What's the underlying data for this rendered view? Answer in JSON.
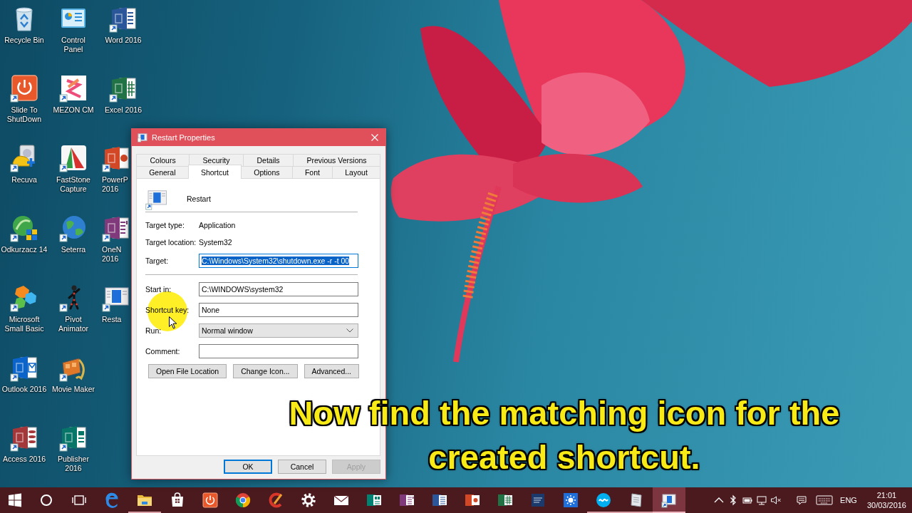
{
  "desktop_icons": [
    {
      "label": "Recycle Bin",
      "partly_covered": false
    },
    {
      "label": "Slide To ShutDown",
      "partly_covered": false
    },
    {
      "label": "Recuva",
      "partly_covered": false
    },
    {
      "label": "Odkurzacz 14",
      "partly_covered": false
    },
    {
      "label": "Microsoft Small Basic",
      "partly_covered": false
    },
    {
      "label": "Outlook 2016",
      "partly_covered": false
    },
    {
      "label": "Access 2016",
      "partly_covered": false
    },
    {
      "label": "Control Panel",
      "partly_covered": false
    },
    {
      "label": "MEZON CM",
      "partly_covered": false
    },
    {
      "label": "FastStone Capture",
      "partly_covered": false
    },
    {
      "label": "Seterra",
      "partly_covered": false
    },
    {
      "label": "Pivot Animator",
      "partly_covered": false
    },
    {
      "label": "Movie Maker",
      "partly_covered": false
    },
    {
      "label": "Publisher 2016",
      "partly_covered": false
    },
    {
      "label": "Word 2016",
      "partly_covered": false
    },
    {
      "label": "Excel 2016",
      "partly_covered": false
    },
    {
      "label": "PowerP 2016",
      "partly_covered": true
    },
    {
      "label": "OneN 2016",
      "partly_covered": true
    },
    {
      "label": "Resta",
      "partly_covered": true
    }
  ],
  "window": {
    "title": "Restart Properties",
    "tab_rows": [
      [
        {
          "label": "Colours",
          "selected": false
        },
        {
          "label": "Security",
          "selected": false
        },
        {
          "label": "Details",
          "selected": false
        },
        {
          "label": "Previous Versions",
          "selected": false
        }
      ],
      [
        {
          "label": "General",
          "selected": false
        },
        {
          "label": "Shortcut",
          "selected": true
        },
        {
          "label": "Options",
          "selected": false
        },
        {
          "label": "Font",
          "selected": false
        },
        {
          "label": "Layout",
          "selected": false
        }
      ]
    ],
    "shortcut_name": "Restart",
    "info_rows": [
      {
        "label": "Target type:",
        "value": "Application"
      },
      {
        "label": "Target location:",
        "value": "System32"
      }
    ],
    "target": {
      "label": "Target:",
      "value": "C:\\Windows\\System32\\shutdown.exe -r -t 00",
      "text_selected": true
    },
    "fields": [
      {
        "kind": "input",
        "label": "Start in:",
        "value": "C:\\WINDOWS\\system32"
      },
      {
        "kind": "input",
        "label": "Shortcut key:",
        "value": "None"
      },
      {
        "kind": "dropdown",
        "label": "Run:",
        "value": "Normal window"
      },
      {
        "kind": "input",
        "label": "Comment:"
      }
    ],
    "actions": [
      "Open File Location",
      "Change Icon...",
      "Advanced..."
    ],
    "footer_buttons": [
      {
        "label": "OK",
        "focused": true,
        "disabled": false
      },
      {
        "label": "Cancel",
        "focused": false,
        "disabled": false
      },
      {
        "label": "Apply",
        "focused": false,
        "disabled": true
      }
    ]
  },
  "caption_lines": [
    "Now find the matching icon for the",
    "created shortcut."
  ],
  "taskbar": {
    "apps": [
      {
        "running": false,
        "selected": false
      },
      {
        "running": true,
        "selected": false
      },
      {
        "running": false,
        "selected": false
      },
      {
        "running": false,
        "selected": false
      },
      {
        "running": false,
        "selected": false
      },
      {
        "running": false,
        "selected": false
      },
      {
        "running": false,
        "selected": false
      },
      {
        "running": false,
        "selected": false
      },
      {
        "running": false,
        "selected": false
      },
      {
        "running": false,
        "selected": false
      },
      {
        "running": false,
        "selected": false
      },
      {
        "running": false,
        "selected": false
      },
      {
        "running": false,
        "selected": false
      },
      {
        "running": false,
        "selected": false
      },
      {
        "running": false,
        "selected": false
      },
      {
        "running": true,
        "selected": false
      },
      {
        "running": true,
        "selected": false
      },
      {
        "running": true,
        "selected": true
      }
    ],
    "language": "ENG",
    "time": "21:01",
    "date": "30/03/2016"
  }
}
